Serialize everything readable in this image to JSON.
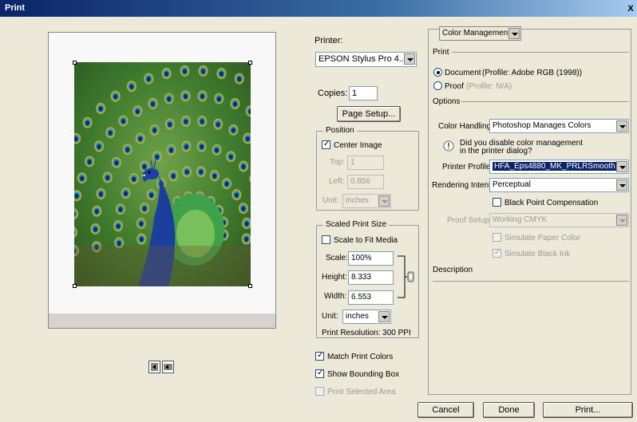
{
  "window": {
    "title": "Print",
    "close_glyph": "X"
  },
  "printer": {
    "label": "Printer:",
    "value": "EPSON Stylus Pro 4..."
  },
  "copies": {
    "label": "Copies:",
    "value": "1"
  },
  "page_setup_label": "Page Setup...",
  "position": {
    "legend": "Position",
    "center_image": {
      "label": "Center Image",
      "checked": true
    },
    "top": {
      "label": "Top:",
      "value": "1"
    },
    "left": {
      "label": "Left:",
      "value": "0.856"
    },
    "unit": {
      "label": "Unit:",
      "value": "inches"
    }
  },
  "scaled": {
    "legend": "Scaled Print Size",
    "scale_to_fit": {
      "label": "Scale to Fit Media",
      "checked": false
    },
    "scale": {
      "label": "Scale:",
      "value": "100%"
    },
    "height": {
      "label": "Height:",
      "value": "8.333"
    },
    "width": {
      "label": "Width:",
      "value": "6.553"
    },
    "unit": {
      "label": "Unit:",
      "value": "inches"
    },
    "resolution": "Print Resolution: 300 PPI"
  },
  "options_bottom": {
    "match_print_colors": {
      "label": "Match Print Colors",
      "checked": true
    },
    "show_bounding_box": {
      "label": "Show Bounding Box",
      "checked": true
    },
    "print_selected_area": {
      "label": "Print Selected Area",
      "checked": false
    }
  },
  "right_panel": {
    "mode_select": "Color Management",
    "print_heading": "Print",
    "document": {
      "label": "Document",
      "profile": "(Profile: Adobe RGB (1998))",
      "selected": true
    },
    "proof": {
      "label": "Proof",
      "profile": "(Profile: N/A)",
      "selected": false
    },
    "options_heading": "Options",
    "color_handling": {
      "label": "Color Handling:",
      "value": "Photoshop Manages Colors"
    },
    "warning_text_1": "Did you disable color management",
    "warning_text_2": "in the printer dialog?",
    "printer_profile": {
      "label": "Printer Profile:",
      "value": "HFA_Eps4880_MK_PRLRSmooth"
    },
    "rendering_intent": {
      "label": "Rendering Intent:",
      "value": "Perceptual"
    },
    "black_point": {
      "label": "Black Point Compensation",
      "checked": false
    },
    "proof_setup": {
      "label": "Proof Setup:",
      "value": "Working CMYK"
    },
    "simulate_paper": {
      "label": "Simulate Paper Color",
      "checked": false
    },
    "simulate_ink": {
      "label": "Simulate Black Ink",
      "checked": true
    },
    "description_heading": "Description"
  },
  "footer": {
    "cancel": "Cancel",
    "done": "Done",
    "print": "Print..."
  },
  "icons": [
    "page-portrait-icon",
    "page-landscape-icon",
    "warning-icon",
    "link-chain-icon"
  ]
}
